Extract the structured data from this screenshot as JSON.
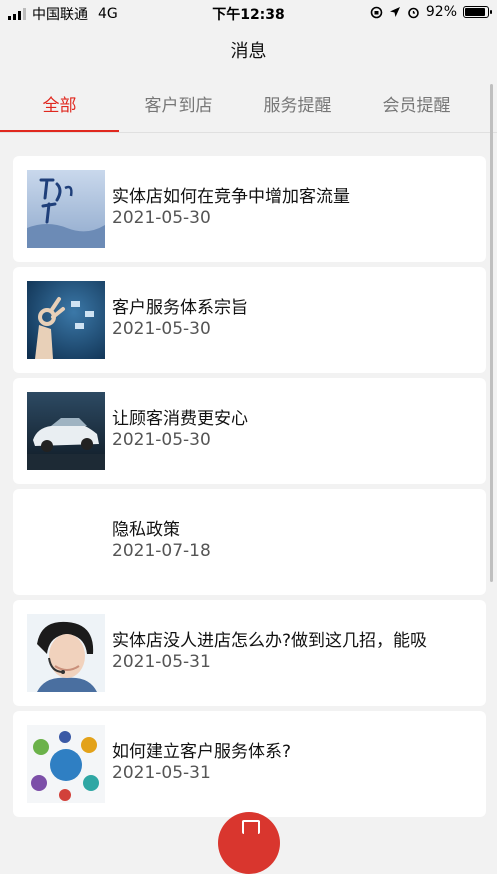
{
  "status_bar": {
    "carrier": "中国联通",
    "network": "4G",
    "time": "下午12:38",
    "battery": "92%",
    "battery_level": 0.92
  },
  "header": {
    "title": "消息"
  },
  "tabs": [
    {
      "label": "全部",
      "active": true
    },
    {
      "label": "客户到店",
      "active": false
    },
    {
      "label": "服务提醒",
      "active": false
    },
    {
      "label": "会员提醒",
      "active": false
    }
  ],
  "messages": [
    {
      "title": "实体店如何在竞争中增加客流量",
      "date": "2021-05-30",
      "thumb": "service-calligraphy-image"
    },
    {
      "title": "客户服务体系宗旨",
      "date": "2021-05-30",
      "thumb": "hand-gesture-image"
    },
    {
      "title": "让顾客消费更安心",
      "date": "2021-05-30",
      "thumb": "car-image"
    },
    {
      "title": "隐私政策",
      "date": "2021-07-18",
      "thumb": ""
    },
    {
      "title": "实体店没人进店怎么办?做到这几招，能吸",
      "date": "2021-05-31",
      "thumb": "customer-service-agent-image"
    },
    {
      "title": "如何建立客户服务体系?",
      "date": "2021-05-31",
      "thumb": "service-diagram-image"
    }
  ],
  "colors": {
    "accent": "#e0281f",
    "fab": "#d9362e",
    "background": "#f2f2f2"
  }
}
